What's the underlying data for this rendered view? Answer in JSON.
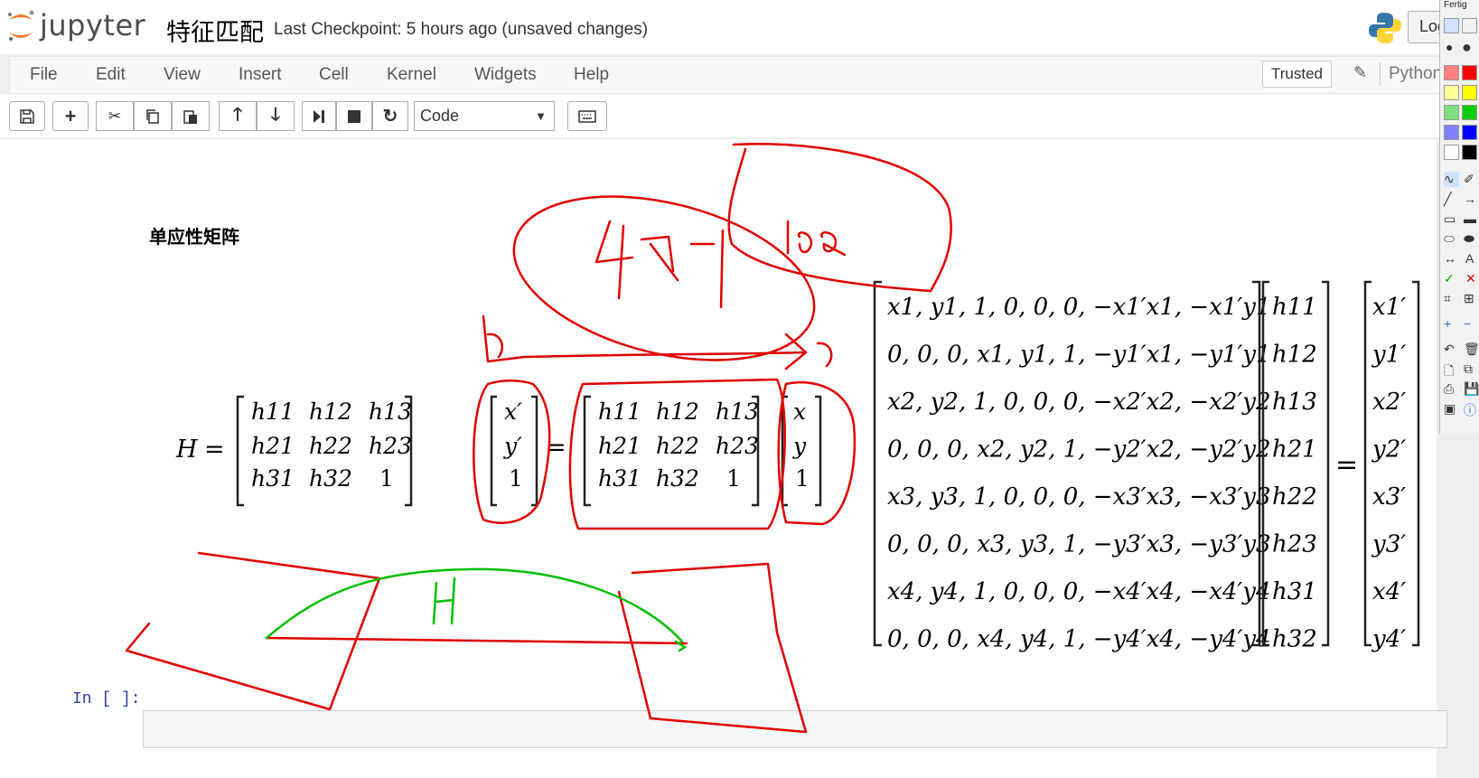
{
  "app": {
    "logo_text": "jupyter",
    "notebook_title": "特征匹配",
    "checkpoint": "Last Checkpoint: 5 hours ago (unsaved changes)",
    "login_label": "Log"
  },
  "menu": {
    "items": [
      "File",
      "Edit",
      "View",
      "Insert",
      "Cell",
      "Kernel",
      "Widgets",
      "Help"
    ],
    "trusted_label": "Trusted",
    "kernel_name": "Python"
  },
  "toolbar": {
    "cell_type": "Code",
    "icons": [
      "save-icon",
      "plus-icon",
      "cut-icon",
      "copy-icon",
      "paste-icon",
      "arrow-up-icon",
      "arrow-down-icon",
      "run-icon",
      "stop-icon",
      "restart-icon",
      "keyboard-icon"
    ]
  },
  "cell": {
    "heading": "单应性矩阵",
    "h_label": "H",
    "equals": "=",
    "matrix_h": [
      [
        "h11",
        "h12",
        "h13"
      ],
      [
        "h21",
        "h22",
        "h23"
      ],
      [
        "h31",
        "h32",
        "1"
      ]
    ],
    "vector_dst": [
      "x′",
      "y′",
      "1"
    ],
    "vector_src": [
      "x",
      "y",
      "1"
    ],
    "system_rows": [
      "x1, y1, 1, 0, 0, 0, −x1′x1, −x1′y1",
      "0, 0, 0, x1, y1, 1, −y1′x1, −y1′y1",
      "x2, y2, 1, 0, 0, 0, −x2′x2, −x2′y2",
      "0, 0, 0, x2, y2, 1, −y2′x2, −y2′y2",
      "x3, y3, 1, 0, 0, 0, −x3′x3, −x3′y3",
      "0, 0, 0, x3, y3, 1, −y3′x3, −y3′y3",
      "x4, y4, 1, 0, 0, 0, −x4′x4, −x4′y4",
      "0, 0, 0, x4, y4, 1, −y4′x4, −y4′y4"
    ],
    "h_vector": [
      "h11",
      "h12",
      "h13",
      "h21",
      "h22",
      "h23",
      "h31",
      "h32"
    ],
    "rhs_vector": [
      "x1′",
      "y1′",
      "x2′",
      "y2′",
      "x3′",
      "y3′",
      "x4′",
      "y4′"
    ]
  },
  "input_cell": {
    "prompt": "In [ ]:"
  },
  "palette": {
    "title": "Fertig",
    "colors": [
      "#ff0000",
      "#ffff00",
      "#00cc00",
      "#0000ff",
      "#000000",
      "#ffffff"
    ]
  },
  "annotations": {
    "color_red": "#e00000",
    "color_green": "#00c000",
    "text_red_1": "4对",
    "text_red_2": "los",
    "text_green": "H"
  }
}
